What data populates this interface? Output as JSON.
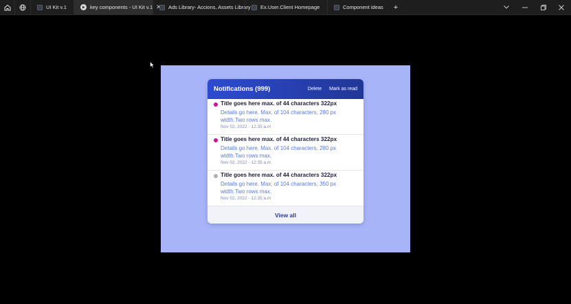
{
  "tabs": [
    {
      "label": "UI Kit v.1",
      "active": false,
      "icon": "figma-file-icon"
    },
    {
      "label": "key components - UI Kit v.1",
      "active": true,
      "icon": "play-icon"
    },
    {
      "label": "Ads Library- Accions, Assets Library",
      "active": false,
      "icon": "figma-file-icon"
    },
    {
      "label": "Ex.User.Client Homepage",
      "active": false,
      "icon": "figma-file-icon"
    },
    {
      "label": "Component ideas",
      "active": false,
      "icon": "figma-file-icon"
    }
  ],
  "notifications": {
    "title": "Notifications (999)",
    "delete_label": "Delete",
    "mark_read_label": "Mark as read",
    "items": [
      {
        "title": "Title goes here max. of 44 characters 322px",
        "details": "Details go here. Max. of 104 characters, 280 px width.Two rows max.",
        "time": "Nov 02, 2022 - 12:35 a.m",
        "unread": true
      },
      {
        "title": "Title goes here max. of 44 characters 322px",
        "details": "Details go here. Max. of 104 characters, 280 px width.Two rows max.",
        "time": "Nov 02, 2022 - 12:35 a.m",
        "unread": true
      },
      {
        "title": "Title goes here max. of 44 characters 322px",
        "details": "Details go here. Max. of 104 characters, 350 px width.Two rows max.",
        "time": "Nov 02, 2022 - 12:35 a.m",
        "unread": false
      }
    ],
    "view_all_label": "View all"
  },
  "colors": {
    "frame_bg": "#a7b4f7",
    "header_start": "#2d4bd0",
    "header_end": "#213796",
    "unread_dot": "#d1109e",
    "read_dot": "#b0b0b0",
    "details_text": "#5a7bd4"
  }
}
